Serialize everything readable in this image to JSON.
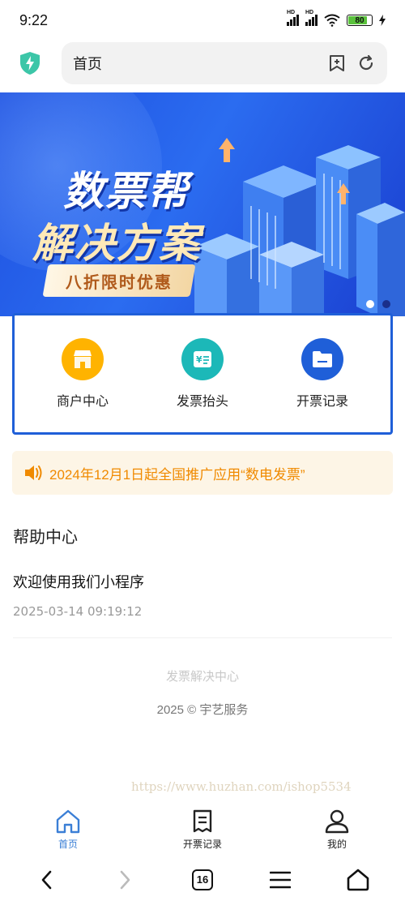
{
  "status_bar": {
    "time": "9:22",
    "network_labels": [
      "HD",
      "HD"
    ],
    "battery": "80"
  },
  "address_bar": {
    "title": "首页",
    "shield_icon": "shield-bolt-icon",
    "add_bookmark_icon": "add-bookmark-icon",
    "refresh_icon": "refresh-icon"
  },
  "banner": {
    "title_line1": "数票帮",
    "title_line2": "解决方案",
    "tag": "八折限时优惠",
    "slide_count": 2,
    "active_slide": 1
  },
  "menu": {
    "items": [
      {
        "label": "商户中心",
        "icon": "store-icon",
        "color": "#ffb300"
      },
      {
        "label": "发票抬头",
        "icon": "invoice-icon",
        "color": "#1cb8b8"
      },
      {
        "label": "开票记录",
        "icon": "folder-icon",
        "color": "#1f5fd8"
      }
    ]
  },
  "notice": {
    "icon": "speaker-icon",
    "text": "2024年12月1日起全国推广应用“数电发票”",
    "color": "#f08a00"
  },
  "help_center": {
    "title": "帮助中心",
    "articles": [
      {
        "title": "欢迎使用我们小程序",
        "date": "2025-03-14 09:19:12"
      }
    ]
  },
  "footer": {
    "link": "发票解决中心",
    "copyright": "2025 © 宇艺服务"
  },
  "watermark": "https://www.huzhan.com/ishop5534",
  "tabbar": {
    "items": [
      {
        "label": "首页",
        "icon": "home-icon",
        "active": true
      },
      {
        "label": "开票记录",
        "icon": "receipt-icon",
        "active": false
      },
      {
        "label": "我的",
        "icon": "user-icon",
        "active": false
      }
    ],
    "accent": "#3b7fd6"
  },
  "system_nav": {
    "tabs_count": "16"
  }
}
